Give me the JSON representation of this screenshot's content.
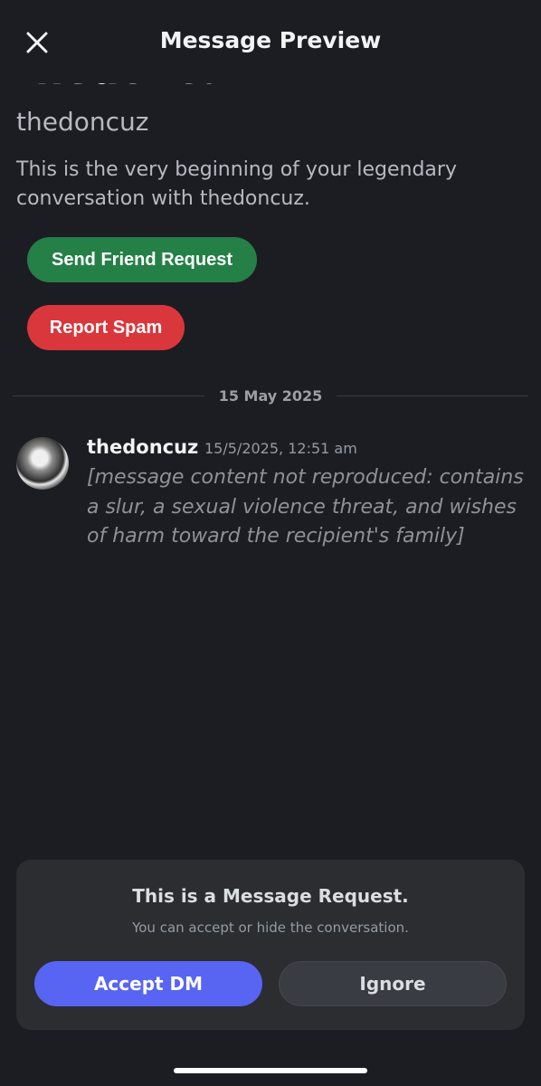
{
  "header": {
    "title": "Message Preview",
    "close_icon": "close-icon"
  },
  "profile": {
    "display_name": "thedoncuz",
    "username": "thedoncuz",
    "intro": "This is the very beginning of your legendary conversation with thedoncuz."
  },
  "actions": {
    "friend_request_label": "Send Friend Request",
    "report_spam_label": "Report Spam"
  },
  "divider": {
    "date": "15 May 2025"
  },
  "message": {
    "author": "thedoncuz",
    "timestamp": "15/5/2025, 12:51 am",
    "body": "[message content not reproduced: contains a slur, a sexual violence threat, and wishes of harm toward the recipient's family]"
  },
  "request_card": {
    "title": "This is a Message Request.",
    "subtitle": "You can accept or hide the conversation.",
    "accept_label": "Accept DM",
    "ignore_label": "Ignore"
  },
  "colors": {
    "background": "#1c1d22",
    "card": "#2b2d31",
    "green": "#248046",
    "red": "#da373c",
    "blurple": "#5865f2"
  }
}
